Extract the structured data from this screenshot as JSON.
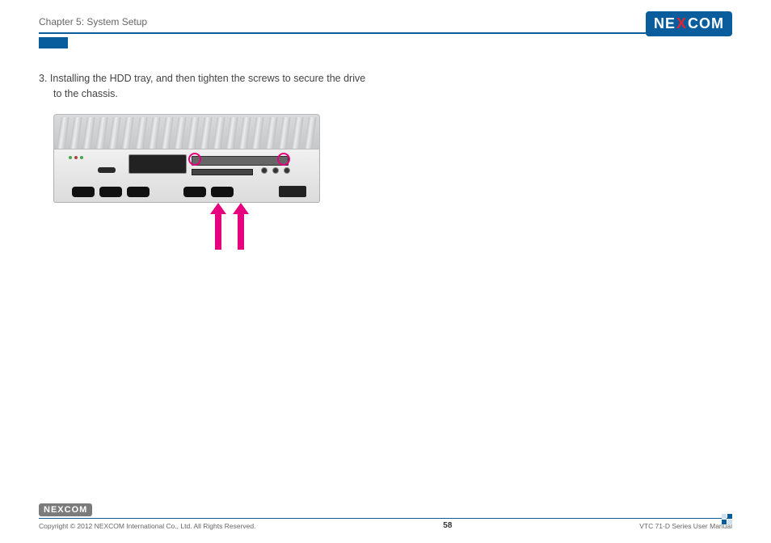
{
  "header": {
    "chapter": "Chapter 5: System Setup"
  },
  "brand": {
    "name_part1": "NE",
    "name_x": "X",
    "name_part2": "COM"
  },
  "instruction": {
    "number": "3.",
    "line1": "Installing the HDD tray, and then tighten the screws to secure the drive",
    "line2": "to the chassis."
  },
  "footer": {
    "copyright": "Copyright © 2012 NEXCOM International Co., Ltd. All Rights Reserved.",
    "page": "58",
    "doc": "VTC 71-D Series User Manual"
  }
}
